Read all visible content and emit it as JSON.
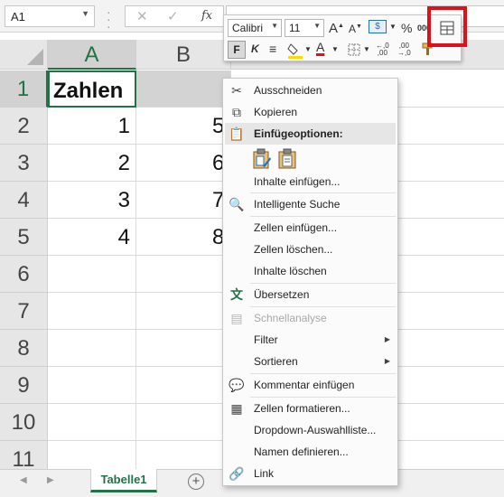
{
  "formula_bar": {
    "name_box": "A1",
    "fx_label": "fx"
  },
  "sheet": {
    "columns": [
      "A",
      "B"
    ],
    "rows": [
      "1",
      "2",
      "3",
      "4",
      "5",
      "6",
      "7",
      "8",
      "9",
      "10",
      "11"
    ],
    "cells": {
      "A1": "Zahlen",
      "A2": "1",
      "A3": "2",
      "A4": "3",
      "A5": "4",
      "B2": "5",
      "B3": "6",
      "B4": "7",
      "B5": "8"
    },
    "tab_name": "Tabelle1",
    "add_sheet_symbol": "+"
  },
  "mini_toolbar": {
    "font_name": "Calibri",
    "font_size": "11",
    "bold_label": "F",
    "italic_label": "K",
    "percent_label": "%",
    "thousands_label": "000"
  },
  "context_menu": {
    "cut": "Ausschneiden",
    "copy": "Kopieren",
    "paste_options": "Einfügeoptionen:",
    "paste_special": "Inhalte einfügen...",
    "smart_lookup": "Intelligente Suche",
    "insert_cells": "Zellen einfügen...",
    "delete_cells": "Zellen löschen...",
    "clear_contents": "Inhalte löschen",
    "translate": "Übersetzen",
    "quick_analysis": "Schnellanalyse",
    "filter": "Filter",
    "sort": "Sortieren",
    "insert_comment": "Kommentar einfügen",
    "format_cells": "Zellen formatieren...",
    "dropdown_list": "Dropdown-Auswahlliste...",
    "define_name": "Namen definieren...",
    "link": "Link"
  },
  "colors": {
    "excel_green": "#217346",
    "highlight_red": "#e0101a"
  }
}
